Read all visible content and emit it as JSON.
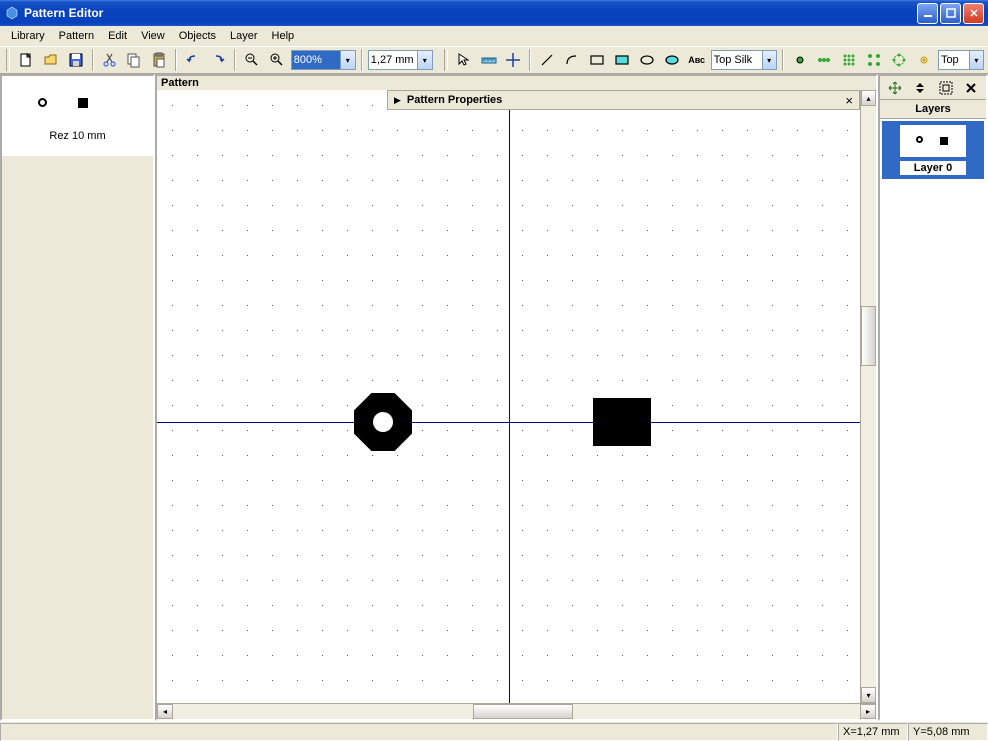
{
  "window": {
    "title": "Pattern Editor"
  },
  "menu": {
    "library": "Library",
    "pattern": "Pattern",
    "edit": "Edit",
    "view": "View",
    "objects": "Objects",
    "layer": "Layer",
    "help": "Help"
  },
  "toolbar": {
    "zoom_value": "800%",
    "grid_value": "1,27 mm",
    "layer_combo": "Top Silk",
    "side_combo": "Top"
  },
  "left": {
    "thumb_label": "Rez 10 mm"
  },
  "center": {
    "section_label": "Pattern",
    "properties_title": "Pattern Properties"
  },
  "right": {
    "layers_title": "Layers",
    "layer0_name": "Layer 0"
  },
  "status": {
    "x": "X=1,27 mm",
    "y": "Y=5,08 mm"
  }
}
